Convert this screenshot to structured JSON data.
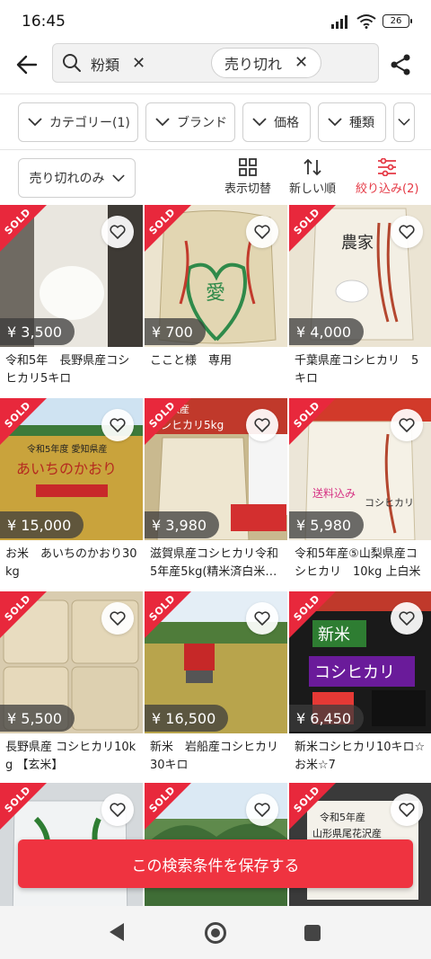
{
  "status": {
    "time": "16:45",
    "battery": "26"
  },
  "search": {
    "chip_partial": "粉類",
    "chip": "売り切れ"
  },
  "filters": [
    "カテゴリー(1)",
    "ブランド",
    "価格",
    "種類"
  ],
  "sort": {
    "sold_only": "売り切れのみ",
    "view_toggle": "表示切替",
    "newest": "新しい順",
    "refine": "絞り込み(2)"
  },
  "accent_color": "#e53945",
  "sold_label": "SOLD",
  "items": [
    {
      "price": "¥ 3,500",
      "title": "令和5年　長野県産コシヒカリ5キロ",
      "sold": true
    },
    {
      "price": "¥ 700",
      "title": "ここと様　専用",
      "sold": true
    },
    {
      "price": "¥ 4,000",
      "title": "千葉県産コシヒカリ　5キロ",
      "sold": true
    },
    {
      "price": "¥ 15,000",
      "title": "お米　あいちのかおり30kg",
      "sold": true
    },
    {
      "price": "¥ 3,980",
      "title": "滋賀県産コシヒカリ令和5年産5kg(精米済白米5...",
      "sold": true
    },
    {
      "price": "¥ 5,980",
      "title": "令和5年産⑤山梨県産コシヒカリ　10kg 上白米",
      "sold": true
    },
    {
      "price": "¥ 5,500",
      "title": "長野県産 コシヒカリ10kg 【玄米】",
      "sold": true
    },
    {
      "price": "¥ 16,500",
      "title": "新米　岩船産コシヒカリ30キロ",
      "sold": true
    },
    {
      "price": "¥ 6,450",
      "title": "新米コシヒカリ10キロ☆お米☆7",
      "sold": true
    },
    {
      "price": "",
      "title": "",
      "sold": true
    },
    {
      "price": "",
      "title": "",
      "sold": true
    },
    {
      "price": "",
      "title": "",
      "sold": true
    }
  ],
  "save_button": "この検索条件を保存する"
}
